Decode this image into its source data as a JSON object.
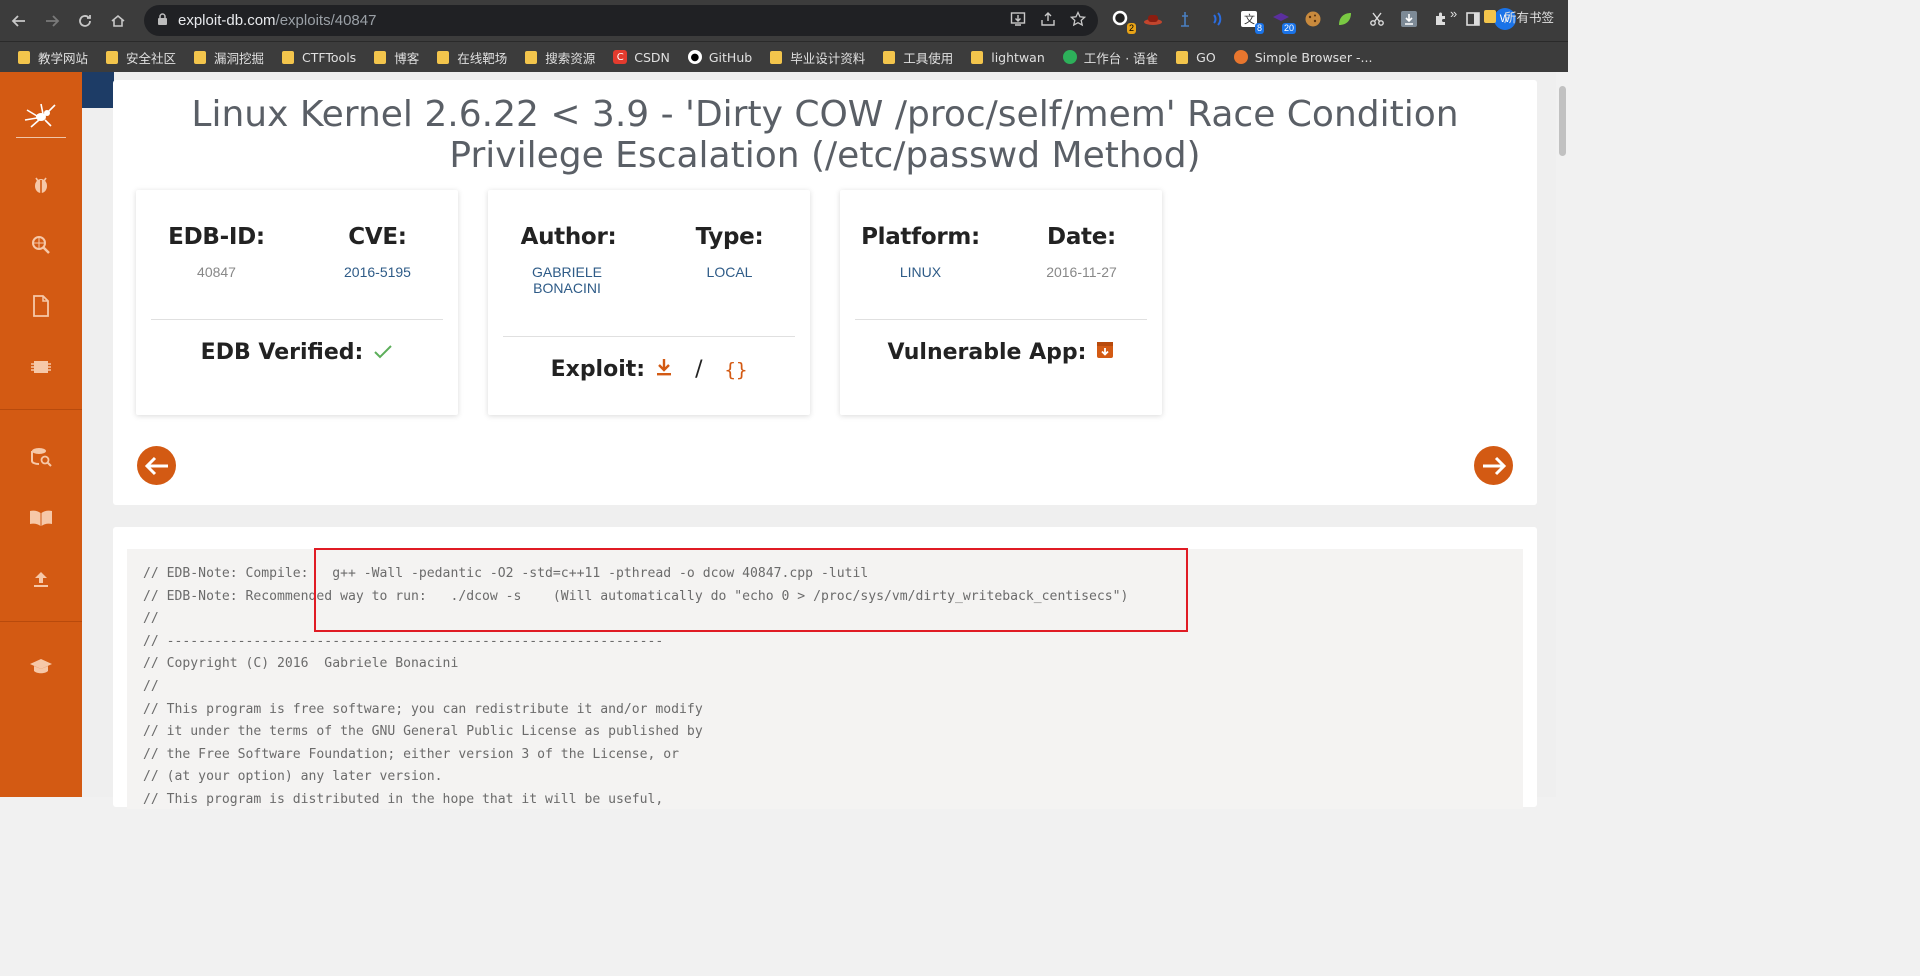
{
  "browser": {
    "url_host": "exploit-db.com",
    "url_path": "/exploits/40847",
    "extensions": [
      {
        "name": "ext-1",
        "badge": "2"
      },
      {
        "name": "ext-2",
        "badge": ""
      },
      {
        "name": "ext-3",
        "badge": ""
      },
      {
        "name": "ext-4",
        "badge": ""
      },
      {
        "name": "ext-5",
        "badge": "8"
      },
      {
        "name": "ext-6",
        "badge": "20"
      }
    ],
    "profile_initial": "W"
  },
  "bookmarks": [
    {
      "label": "教学网站",
      "type": "folder"
    },
    {
      "label": "安全社区",
      "type": "folder"
    },
    {
      "label": "漏洞挖掘",
      "type": "folder"
    },
    {
      "label": "CTFTools",
      "type": "folder"
    },
    {
      "label": "博客",
      "type": "folder"
    },
    {
      "label": "在线靶场",
      "type": "folder"
    },
    {
      "label": "搜索资源",
      "type": "folder"
    },
    {
      "label": "CSDN",
      "type": "csdn"
    },
    {
      "label": "GitHub",
      "type": "github"
    },
    {
      "label": "毕业设计资料",
      "type": "folder"
    },
    {
      "label": "工具使用",
      "type": "folder"
    },
    {
      "label": "lightwan",
      "type": "folder"
    },
    {
      "label": "工作台 · 语雀",
      "type": "yuque"
    },
    {
      "label": "GO",
      "type": "folder"
    },
    {
      "label": "Simple Browser -...",
      "type": "simple"
    }
  ],
  "bookmarks_more": "»",
  "bookmarks_all": "所有书签",
  "exploit": {
    "title": "Linux Kernel 2.6.22 < 3.9 - 'Dirty COW /proc/self/mem' Race Condition Privilege Escalation (/etc/passwd Method)",
    "edb_id_label": "EDB-ID:",
    "edb_id": "40847",
    "cve_label": "CVE:",
    "cve": "2016-5195",
    "author_label": "Author:",
    "author": "GABRIELE BONACINI",
    "type_label": "Type:",
    "type": "LOCAL",
    "platform_label": "Platform:",
    "platform": "LINUX",
    "date_label": "Date:",
    "date": "2016-11-27",
    "verified_label": "EDB Verified:",
    "exploit_label": "Exploit:",
    "exploit_sep": "/",
    "raw_icon": "{}",
    "vuln_app_label": "Vulnerable App:"
  },
  "code_lines": [
    "// EDB-Note: Compile:   g++ -Wall -pedantic -O2 -std=c++11 -pthread -o dcow 40847.cpp -lutil",
    "// EDB-Note: Recommended way to run:   ./dcow -s    (Will automatically do \"echo 0 > /proc/sys/vm/dirty_writeback_centisecs\")",
    "//",
    "// ---------------------------------------------------------------",
    "// Copyright (C) 2016  Gabriele Bonacini",
    "//",
    "// This program is free software; you can redistribute it and/or modify",
    "// it under the terms of the GNU General Public License as published by",
    "// the Free Software Foundation; either version 3 of the License, or",
    "// (at your option) any later version.",
    "// This program is distributed in the hope that it will be useful,"
  ],
  "colors": {
    "accent": "#d35a13",
    "highlight_box": "#e01b24"
  }
}
